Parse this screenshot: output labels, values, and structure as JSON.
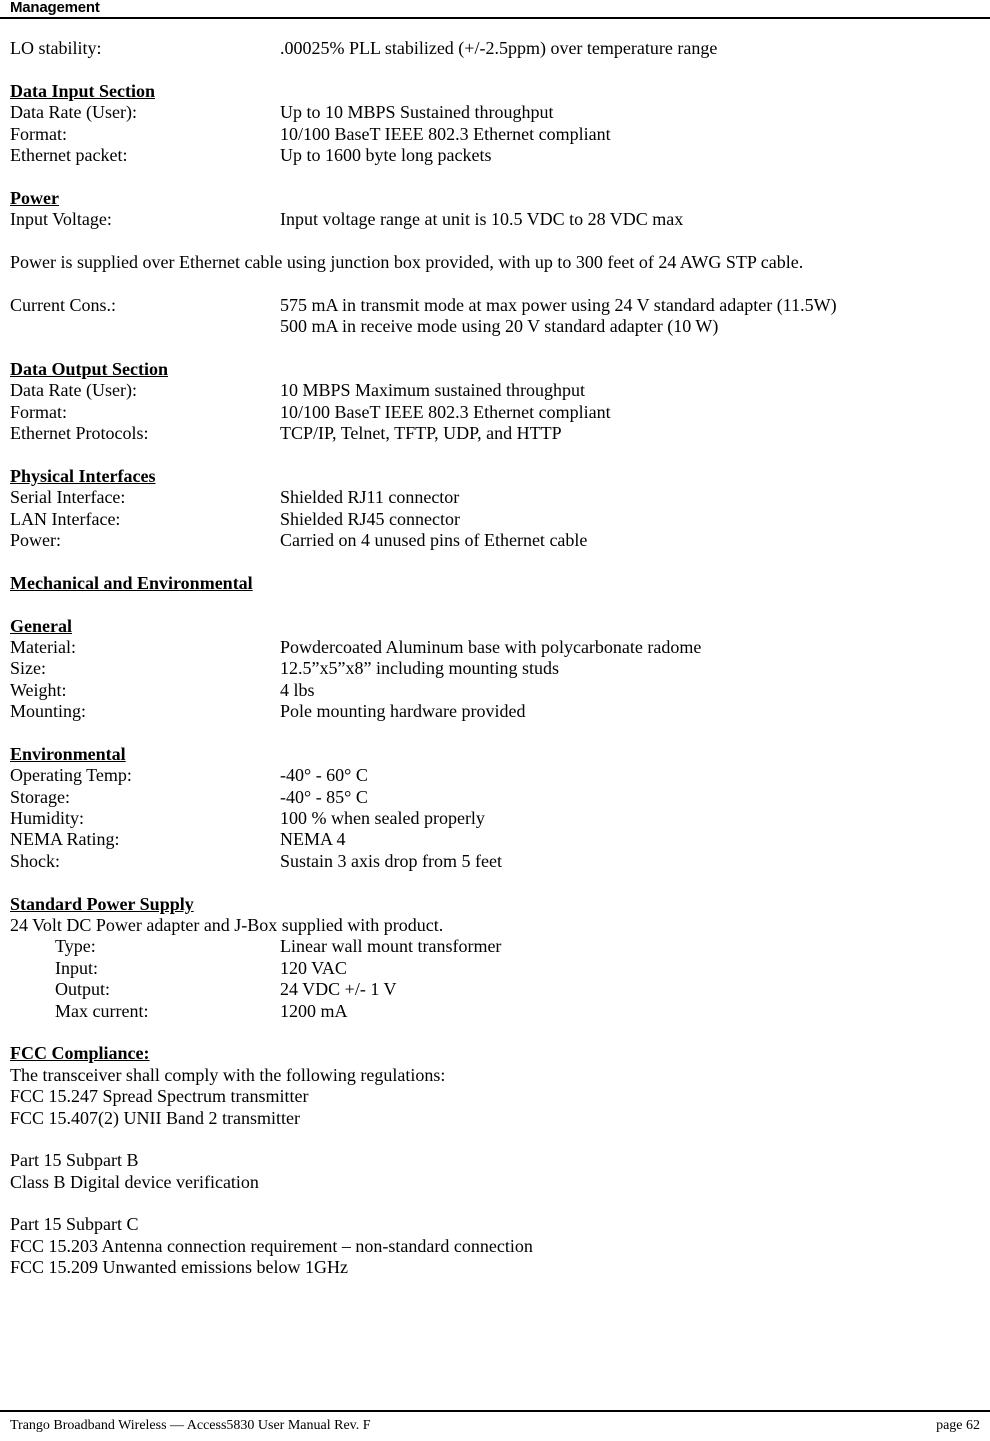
{
  "header": {
    "title": "Management"
  },
  "content": {
    "lo_stability": {
      "label": "LO stability:",
      "value": ".00025% PLL stabilized (+/-2.5ppm) over temperature range"
    },
    "data_input_section": {
      "heading": "Data Input Section",
      "rows": [
        {
          "label": "Data Rate (User):",
          "value": "Up to 10 MBPS Sustained throughput"
        },
        {
          "label": "Format:",
          "value": "10/100 BaseT IEEE 802.3 Ethernet compliant"
        },
        {
          "label": "Ethernet packet:",
          "value": "Up to 1600 byte long packets"
        }
      ]
    },
    "power": {
      "heading": "Power",
      "rows": [
        {
          "label": "Input Voltage:",
          "value": "Input voltage range at unit is 10.5 VDC to 28 VDC max"
        }
      ],
      "paragraph": "Power is supplied over Ethernet cable using junction box provided, with up to 300 feet of 24 AWG STP cable.",
      "current_cons": {
        "label": "Current Cons.:",
        "value_line_1": "575 mA in transmit mode at max power using 24 V standard adapter (11.5W)",
        "value_line_2": "500 mA in receive mode using 20 V standard adapter (10 W)"
      }
    },
    "data_output_section": {
      "heading": "Data Output Section",
      "rows": [
        {
          "label": "Data Rate (User):",
          "value": "10 MBPS Maximum sustained throughput"
        },
        {
          "label": "Format:",
          "value": "10/100 BaseT IEEE 802.3 Ethernet compliant"
        },
        {
          "label": "Ethernet Protocols:",
          "value": "TCP/IP, Telnet, TFTP, UDP, and HTTP"
        }
      ]
    },
    "physical_interfaces": {
      "heading": "Physical Interfaces",
      "rows": [
        {
          "label": "Serial Interface:",
          "value": "Shielded RJ11 connector"
        },
        {
          "label": "LAN Interface:",
          "value": "Shielded RJ45 connector"
        },
        {
          "label": "Power:",
          "value": "Carried on 4 unused pins of Ethernet cable"
        }
      ]
    },
    "mechanical_and_environmental": {
      "heading": "Mechanical and Environmental"
    },
    "general": {
      "heading": "General",
      "rows": [
        {
          "label": "Material:",
          "value": "Powdercoated Aluminum base with polycarbonate radome"
        },
        {
          "label": "Size:",
          "value": "12.5”x5”x8” including mounting studs"
        },
        {
          "label": "Weight:",
          "value": "4 lbs"
        },
        {
          "label": "Mounting:",
          "value": "Pole mounting hardware provided"
        }
      ]
    },
    "environmental": {
      "heading": "Environmental",
      "rows": [
        {
          "label": "Operating Temp:",
          "value": "-40° - 60° C"
        },
        {
          "label": "Storage:",
          "value": "-40° - 85° C"
        },
        {
          "label": "Humidity:",
          "value": "100 % when sealed properly"
        },
        {
          "label": "NEMA Rating:",
          "value": "NEMA 4"
        },
        {
          "label": "Shock:",
          "value": "Sustain 3 axis drop from 5 feet"
        }
      ]
    },
    "standard_power_supply": {
      "heading": "Standard Power Supply",
      "intro": "24 Volt DC Power adapter and J-Box supplied with product.",
      "rows": [
        {
          "label": "Type:",
          "value": "Linear wall mount transformer"
        },
        {
          "label": "Input:",
          "value": "120 VAC"
        },
        {
          "label": "Output:",
          "value": "24 VDC +/- 1 V"
        },
        {
          "label": "Max current:",
          "value": "1200 mA"
        }
      ]
    },
    "fcc_compliance": {
      "heading": "FCC Compliance:",
      "intro": "The transceiver shall comply with the following regulations:",
      "lines_group_1": [
        "FCC 15.247 Spread Spectrum transmitter",
        "FCC 15.407(2) UNII Band 2 transmitter"
      ],
      "lines_group_2": [
        "Part 15 Subpart B",
        "Class B Digital device verification"
      ],
      "lines_group_3": [
        "Part 15 Subpart C",
        "FCC 15.203 Antenna connection requirement – non-standard connection",
        "FCC 15.209 Unwanted emissions below 1GHz"
      ]
    }
  },
  "footer": {
    "left": "Trango Broadband Wireless — Access5830 User Manual  Rev. F",
    "right": "page 62"
  }
}
